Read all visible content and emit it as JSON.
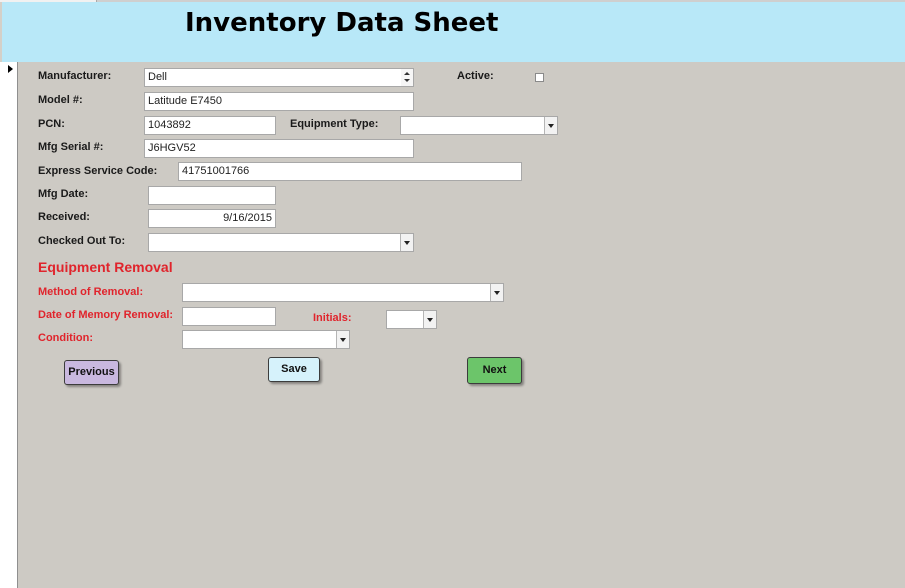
{
  "form": {
    "title": "Inventory Data Sheet"
  },
  "fields": {
    "manufacturer": {
      "label": "Manufacturer:",
      "value": "Dell"
    },
    "active": {
      "label": "Active:",
      "checked": false
    },
    "model": {
      "label": "Model #:",
      "value": "Latitude E7450"
    },
    "pcn": {
      "label": "PCN:",
      "value": "1043892"
    },
    "equipment_type": {
      "label": "Equipment Type:",
      "value": ""
    },
    "mfg_serial": {
      "label": "Mfg Serial #:",
      "value": "J6HGV52"
    },
    "express_service_code": {
      "label": "Express Service Code:",
      "value": "41751001766"
    },
    "mfg_date": {
      "label": "Mfg Date:",
      "value": ""
    },
    "received": {
      "label": "Received:",
      "value": "9/16/2015"
    },
    "checked_out_to": {
      "label": "Checked Out To:",
      "value": ""
    }
  },
  "removal": {
    "heading": "Equipment Removal",
    "method": {
      "label": "Method of Removal:",
      "value": ""
    },
    "memory_date": {
      "label": "Date of Memory Removal:",
      "value": ""
    },
    "initials": {
      "label": "Initials:",
      "value": ""
    },
    "condition": {
      "label": "Condition:",
      "value": ""
    }
  },
  "buttons": {
    "previous": {
      "label": "Previous",
      "color": "#c9b8df"
    },
    "save": {
      "label": "Save",
      "color": "#d6f2fb"
    },
    "next": {
      "label": "Next",
      "color": "#6cc56a"
    }
  },
  "colors": {
    "header_bg": "#b8e8f8",
    "detail_bg": "#cdcac4",
    "accent_red": "#e0242c"
  }
}
